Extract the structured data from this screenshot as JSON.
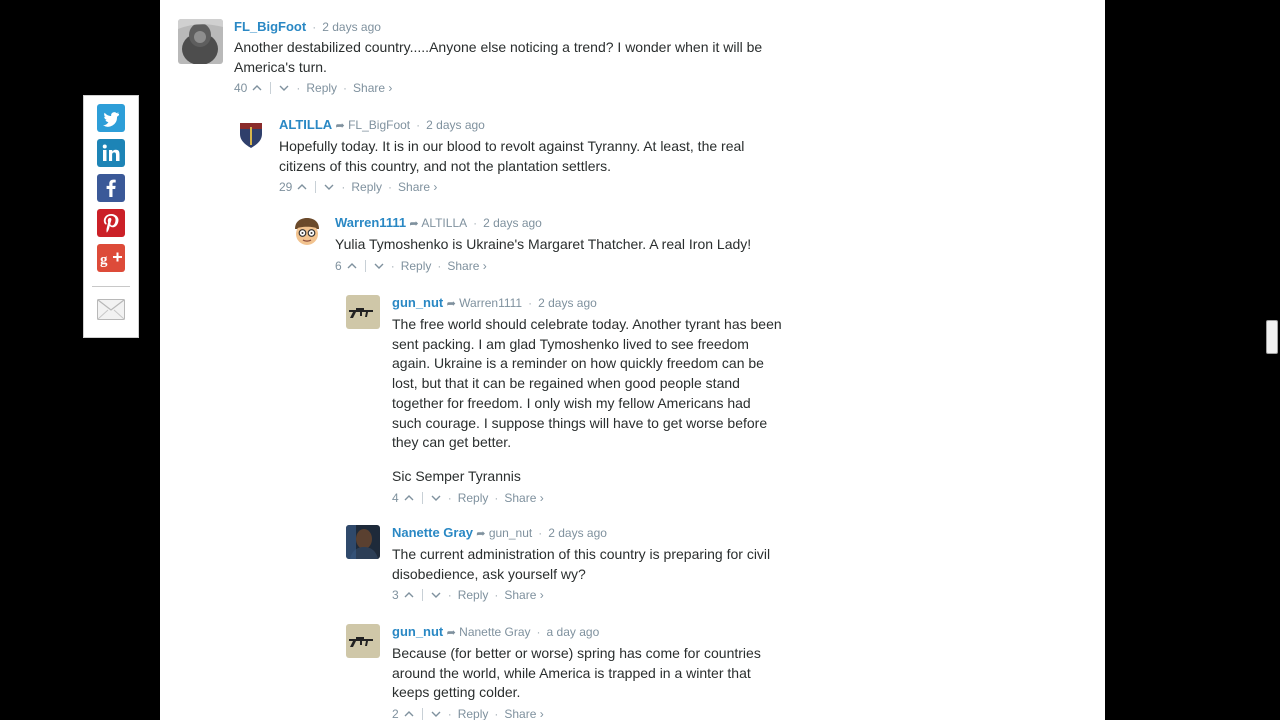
{
  "share_bar": {
    "buttons": [
      {
        "name": "twitter",
        "color": "#2d9ed8"
      },
      {
        "name": "linkedin",
        "color": "#1d84b6"
      },
      {
        "name": "facebook",
        "color": "#3b5998"
      },
      {
        "name": "pinterest",
        "color": "#cb2027"
      },
      {
        "name": "google-plus",
        "color": "#dd4b39"
      },
      {
        "name": "email",
        "color": "#eeeeee"
      }
    ]
  },
  "comments": [
    {
      "author": "FL_BigFoot",
      "reply_to": "",
      "time": "2 days ago",
      "paragraphs": [
        "Another destabilized country.....Anyone else noticing a trend? I wonder when it will be America's turn."
      ],
      "votes": "40",
      "reply_label": "Reply",
      "share_label": "Share ›"
    },
    {
      "author": "ALTILLA",
      "reply_to": "FL_BigFoot",
      "time": "2 days ago",
      "paragraphs": [
        "Hopefully today. It is in our blood to revolt against Tyranny. At least, the real citizens of this country, and not the plantation settlers."
      ],
      "votes": "29",
      "reply_label": "Reply",
      "share_label": "Share ›"
    },
    {
      "author": "Warren1111",
      "reply_to": "ALTILLA",
      "time": "2 days ago",
      "paragraphs": [
        "Yulia Tymoshenko is Ukraine's Margaret Thatcher. A real Iron Lady!"
      ],
      "votes": "6",
      "reply_label": "Reply",
      "share_label": "Share ›"
    },
    {
      "author": "gun_nut",
      "reply_to": "Warren1111",
      "time": "2 days ago",
      "paragraphs": [
        "The free world should celebrate today. Another tyrant has been sent packing. I am glad Tymoshenko lived to see freedom again. Ukraine is a reminder on how quickly freedom can be lost, but that it can be regained when good people stand together for freedom. I only wish my fellow Americans had such courage. I suppose things will have to get worse before they can get better.",
        "Sic Semper Tyrannis"
      ],
      "votes": "4",
      "reply_label": "Reply",
      "share_label": "Share ›"
    },
    {
      "author": "Nanette Gray",
      "reply_to": "gun_nut",
      "time": "2 days ago",
      "paragraphs": [
        "The current administration of this country is preparing for civil disobedience, ask yourself wy?"
      ],
      "votes": "3",
      "reply_label": "Reply",
      "share_label": "Share ›"
    },
    {
      "author": "gun_nut",
      "reply_to": "Nanette Gray",
      "time": "a day ago",
      "paragraphs": [
        "Because (for better or worse) spring has come for countries around the world, while America is trapped in a winter that keeps getting colder."
      ],
      "votes": "2",
      "reply_label": "Reply",
      "share_label": "Share ›"
    }
  ]
}
